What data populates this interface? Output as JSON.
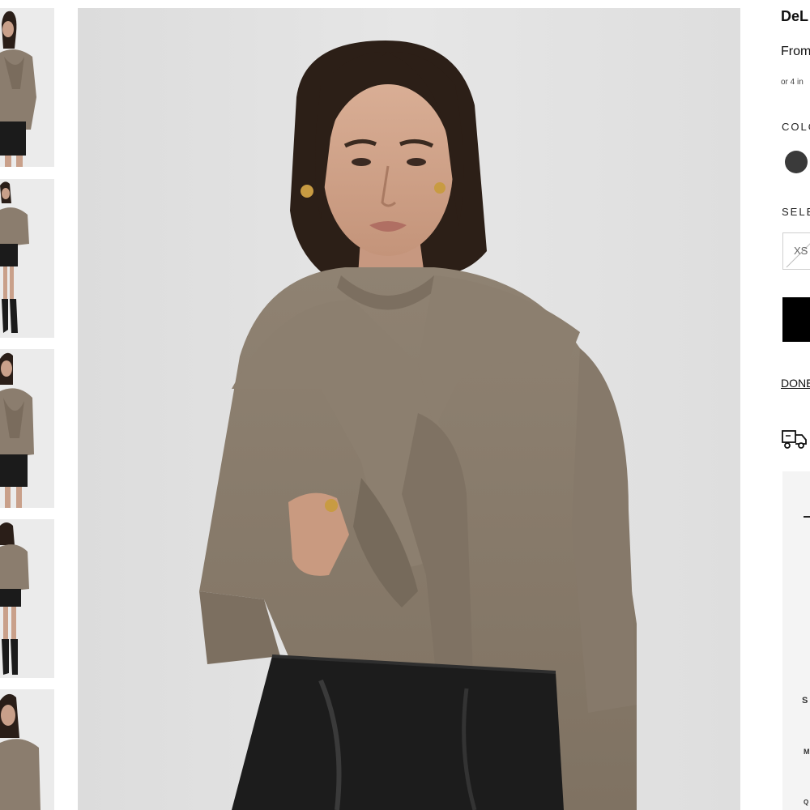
{
  "product": {
    "title": "DeL",
    "price": "From",
    "installments": "or 4 in"
  },
  "options": {
    "color_label": "COLO",
    "color_swatch": "#3a3a3a",
    "size_label": "SELE",
    "size_option": "XS"
  },
  "actions": {
    "add_to_bag_color": "#000000",
    "link_text": "DONE"
  },
  "promo": {
    "s_text": "S",
    "m_text": "M",
    "q_text": "Q"
  },
  "thumbnails": [
    {
      "icon": "product-thumbnail"
    },
    {
      "icon": "product-thumbnail"
    },
    {
      "icon": "product-thumbnail"
    },
    {
      "icon": "product-thumbnail"
    },
    {
      "icon": "product-thumbnail"
    }
  ]
}
